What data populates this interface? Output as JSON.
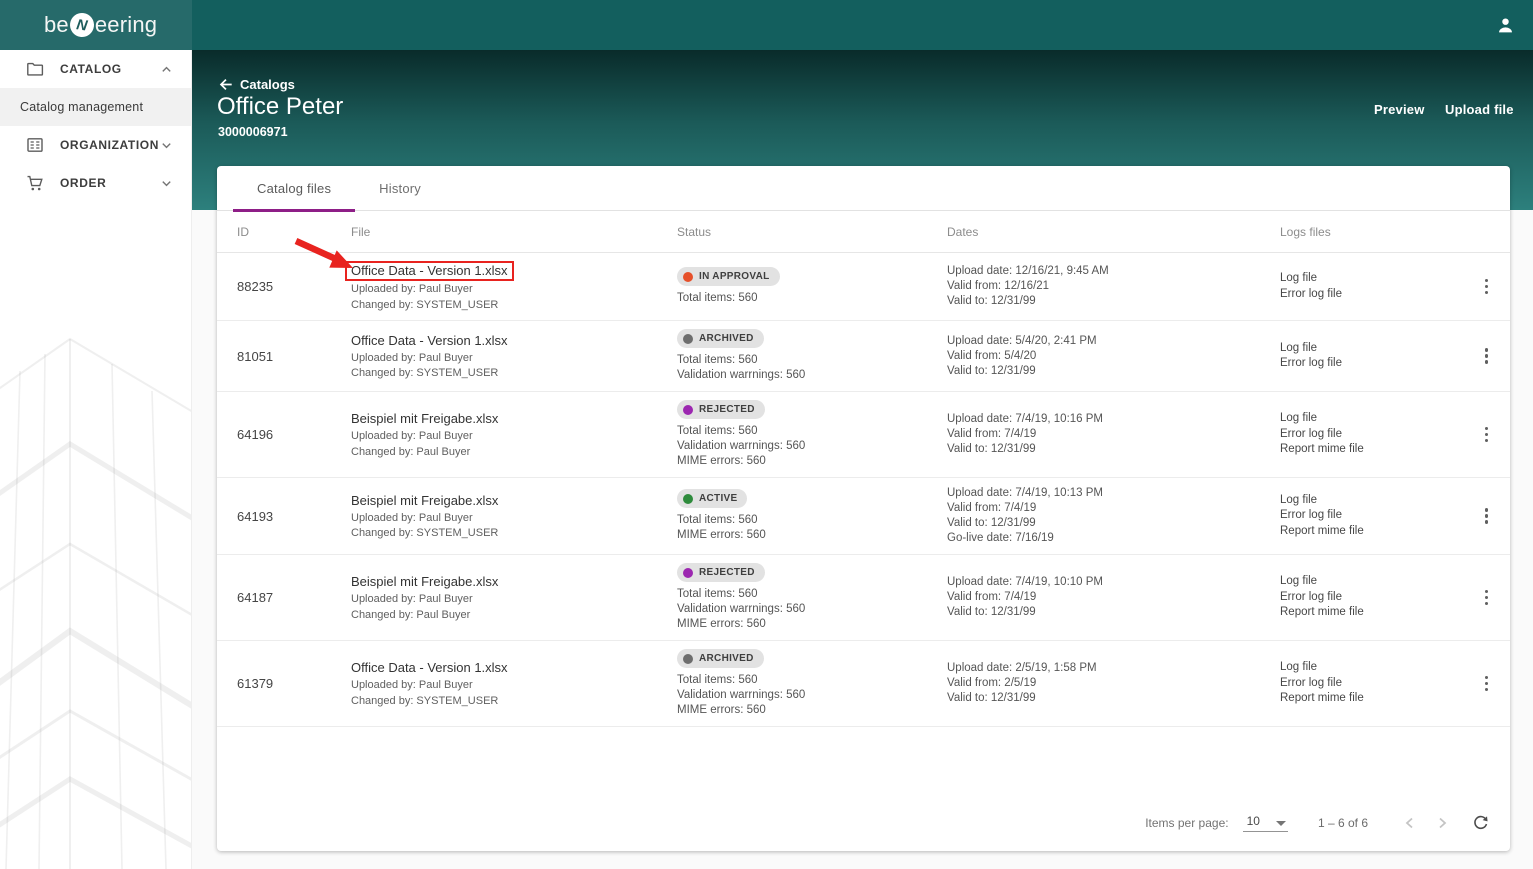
{
  "app_bar": {
    "logo_text_left": "be",
    "logo_text_n": "N",
    "logo_text_right": "eering"
  },
  "sidebar": {
    "items": [
      {
        "label": "CATALOG",
        "icon": "folder-icon",
        "expanded": true
      },
      {
        "label": "Catalog management",
        "selected": true
      },
      {
        "label": "ORGANIZATION",
        "icon": "organization-icon",
        "expanded": false
      },
      {
        "label": "ORDER",
        "icon": "cart-icon",
        "expanded": false
      }
    ]
  },
  "header": {
    "back": "Catalogs",
    "title": "Office Peter",
    "catalog_id": "3000006971",
    "preview_label": "Preview",
    "upload_label": "Upload file"
  },
  "tabs": {
    "catalog_files": "Catalog files",
    "history": "History"
  },
  "table": {
    "columns": {
      "id": "ID",
      "file": "File",
      "status": "Status",
      "dates": "Dates",
      "logs": "Logs files"
    },
    "rows": [
      {
        "id": "88235",
        "file": "Office Data - Version 1.xlsx",
        "uploaded_by": "Uploaded by: Paul Buyer",
        "changed_by": "Changed by: SYSTEM_USER",
        "status": {
          "label": "IN APPROVAL",
          "color": "#e6502a"
        },
        "status_lines": [
          "Total items: 560"
        ],
        "dates": [
          "Upload date: 12/16/21, 9:45 AM",
          "Valid from: 12/16/21",
          "Valid to: 12/31/99"
        ],
        "logs": [
          "Log file",
          "Error log file"
        ],
        "annotated": true
      },
      {
        "id": "81051",
        "file": "Office Data - Version 1.xlsx",
        "uploaded_by": "Uploaded by: Paul Buyer",
        "changed_by": "Changed by: SYSTEM_USER",
        "status": {
          "label": "ARCHIVED",
          "color": "#6d6d6d"
        },
        "status_lines": [
          "Total items: 560",
          "Validation warrnings: 560"
        ],
        "dates": [
          "Upload date: 5/4/20, 2:41 PM",
          "Valid from: 5/4/20",
          "Valid to: 12/31/99"
        ],
        "logs": [
          "Log file",
          "Error log file"
        ],
        "annotated": false
      },
      {
        "id": "64196",
        "file": "Beispiel mit Freigabe.xlsx",
        "uploaded_by": "Uploaded by: Paul Buyer",
        "changed_by": "Changed by: Paul Buyer",
        "status": {
          "label": "REJECTED",
          "color": "#9c27b0"
        },
        "status_lines": [
          "Total items: 560",
          "Validation warrnings: 560",
          "MIME errors: 560"
        ],
        "dates": [
          "Upload date: 7/4/19, 10:16 PM",
          "Valid from: 7/4/19",
          "Valid to: 12/31/99"
        ],
        "logs": [
          "Log file",
          "Error log file",
          "Report mime file"
        ],
        "annotated": false
      },
      {
        "id": "64193",
        "file": "Beispiel mit Freigabe.xlsx",
        "uploaded_by": "Uploaded by: Paul Buyer",
        "changed_by": "Changed by: SYSTEM_USER",
        "status": {
          "label": "ACTIVE",
          "color": "#2e8b3c"
        },
        "status_lines": [
          "Total items: 560",
          "MIME errors: 560"
        ],
        "dates": [
          "Upload date: 7/4/19, 10:13 PM",
          "Valid from: 7/4/19",
          "Valid to: 12/31/99",
          "Go-live date: 7/16/19"
        ],
        "logs": [
          "Log file",
          "Error log file",
          "Report mime file"
        ],
        "annotated": false
      },
      {
        "id": "64187",
        "file": "Beispiel mit Freigabe.xlsx",
        "uploaded_by": "Uploaded by: Paul Buyer",
        "changed_by": "Changed by: Paul Buyer",
        "status": {
          "label": "REJECTED",
          "color": "#9c27b0"
        },
        "status_lines": [
          "Total items: 560",
          "Validation warrnings: 560",
          "MIME errors: 560"
        ],
        "dates": [
          "Upload date: 7/4/19, 10:10 PM",
          "Valid from: 7/4/19",
          "Valid to: 12/31/99"
        ],
        "logs": [
          "Log file",
          "Error log file",
          "Report mime file"
        ],
        "annotated": false
      },
      {
        "id": "61379",
        "file": "Office Data - Version 1.xlsx",
        "uploaded_by": "Uploaded by: Paul Buyer",
        "changed_by": "Changed by: SYSTEM_USER",
        "status": {
          "label": "ARCHIVED",
          "color": "#6d6d6d"
        },
        "status_lines": [
          "Total items: 560",
          "Validation warrnings: 560",
          "MIME errors: 560"
        ],
        "dates": [
          "Upload date: 2/5/19, 1:58 PM",
          "Valid from: 2/5/19",
          "Valid to: 12/31/99"
        ],
        "logs": [
          "Log file",
          "Error log file",
          "Report mime file"
        ],
        "annotated": false
      }
    ]
  },
  "paginator": {
    "items_per_page_label": "Items per page:",
    "page_size": "10",
    "range": "1 – 6 of 6"
  },
  "annotation": {
    "color": "#e8231f",
    "target_row_index": 0
  }
}
